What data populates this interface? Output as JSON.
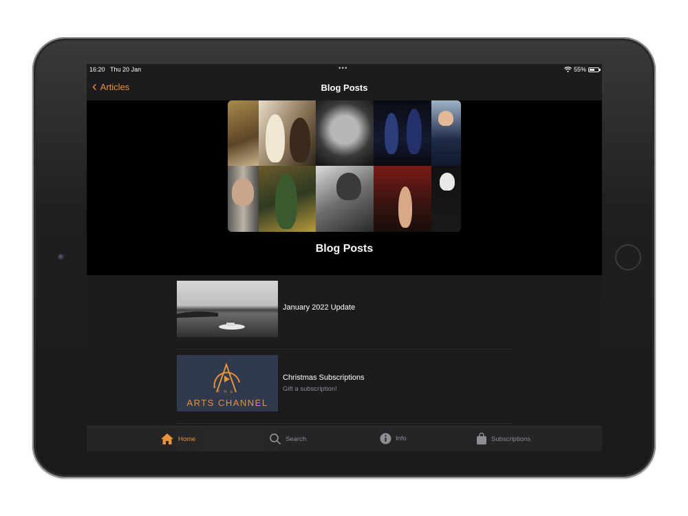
{
  "status": {
    "time": "16:20",
    "date": "Thu 20 Jan",
    "battery": "55%",
    "battery_level": 0.55,
    "multitask_dots": "•••"
  },
  "nav": {
    "back_label": "Articles",
    "title": "Blog Posts"
  },
  "hero": {
    "title": "Blog Posts"
  },
  "posts": [
    {
      "title": "January 2022 Update",
      "subtitle": ""
    },
    {
      "title": "Christmas Subscriptions",
      "subtitle": "Gift a subscription!"
    }
  ],
  "logo": {
    "line1": "THE",
    "line2": "ARTS CHANNEL"
  },
  "tabs": [
    {
      "label": "Home",
      "icon": "home-icon",
      "active": true
    },
    {
      "label": "Search",
      "icon": "search-icon",
      "active": false
    },
    {
      "label": "Info",
      "icon": "info-icon",
      "active": false
    },
    {
      "label": "Subscriptions",
      "icon": "bag-icon",
      "active": false
    }
  ],
  "colors": {
    "accent": "#e8923a",
    "background": "#1c1c1e",
    "hero_background": "#000000"
  }
}
